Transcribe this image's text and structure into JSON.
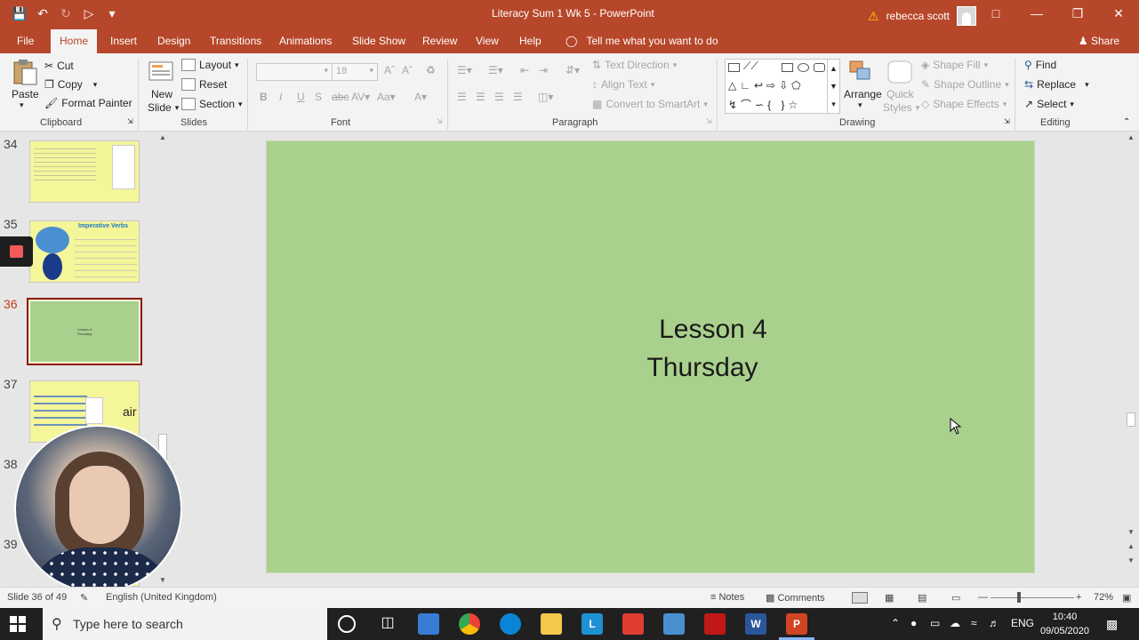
{
  "window": {
    "title": "Literacy Sum 1 Wk 5  -  PowerPoint",
    "user_name": "rebecca scott"
  },
  "tabs": [
    "File",
    "Home",
    "Insert",
    "Design",
    "Transitions",
    "Animations",
    "Slide Show",
    "Review",
    "View",
    "Help"
  ],
  "tell_me": "Tell me what you want to do",
  "share": "Share",
  "ribbon": {
    "clipboard": {
      "paste": "Paste",
      "cut": "Cut",
      "copy": "Copy",
      "format_painter": "Format Painter",
      "label": "Clipboard"
    },
    "slides": {
      "new_slide_1": "New",
      "new_slide_2": "Slide",
      "layout": "Layout",
      "reset": "Reset",
      "section": "Section",
      "label": "Slides"
    },
    "font": {
      "font_size": "18",
      "label": "Font"
    },
    "paragraph": {
      "text_direction": "Text Direction",
      "align_text": "Align Text",
      "convert_smartart": "Convert to SmartArt",
      "label": "Paragraph"
    },
    "drawing": {
      "arrange": "Arrange",
      "quick_styles_1": "Quick",
      "quick_styles_2": "Styles",
      "shape_fill": "Shape Fill",
      "shape_outline": "Shape Outline",
      "shape_effects": "Shape Effects",
      "label": "Drawing"
    },
    "editing": {
      "find": "Find",
      "replace": "Replace",
      "select": "Select",
      "label": "Editing"
    }
  },
  "thumbnails": [
    {
      "number": "34",
      "bg": "#f5f59a"
    },
    {
      "number": "35",
      "bg": "#f5f59a",
      "heading": "Imperative Verbs"
    },
    {
      "number": "36",
      "bg": "#a9d18e",
      "selected": true,
      "line1": "Lesson 4",
      "line2": "Thursday"
    },
    {
      "number": "37",
      "bg": "#f5f59a",
      "word": "air"
    },
    {
      "number": "38"
    },
    {
      "number": "39"
    }
  ],
  "slide": {
    "line1": "Lesson 4",
    "line2": "Thursday",
    "background": "#aad08e"
  },
  "status": {
    "slide_counter": "Slide 36 of 49",
    "language": "English (United Kingdom)",
    "notes": "Notes",
    "comments": "Comments",
    "zoom": "72%"
  },
  "taskbar": {
    "search_placeholder": "Type here to search",
    "language": "ENG",
    "time": "10:40",
    "date": "09/05/2020"
  },
  "colors": {
    "accent": "#b7472a",
    "slide_green": "#aad08e",
    "thumb_yellow": "#f5f59a"
  }
}
